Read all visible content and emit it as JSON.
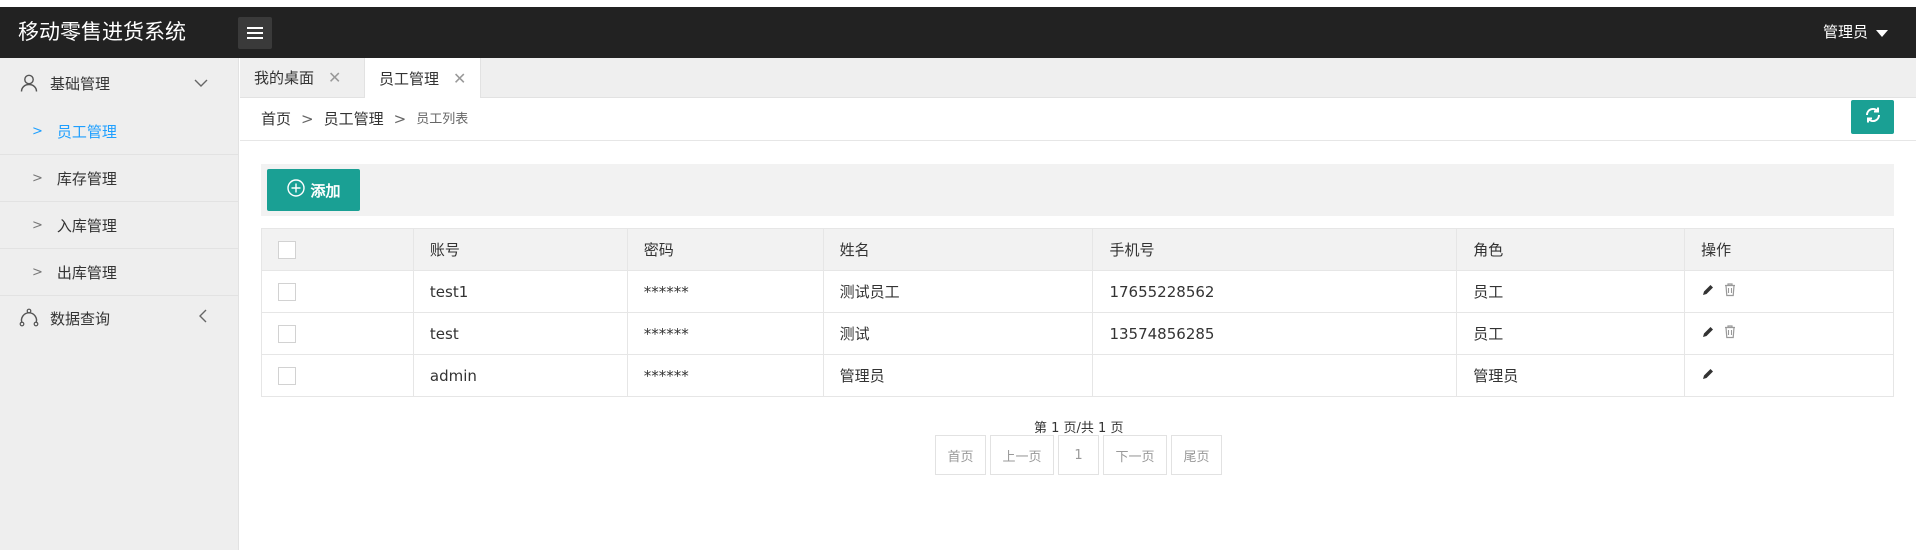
{
  "header": {
    "app_title": "移动零售进货系统",
    "user_label": "管理员"
  },
  "sidebar": {
    "groups": [
      {
        "label": "基础管理",
        "icon": "user-icon",
        "expanded": true,
        "items": [
          {
            "label": "员工管理",
            "active": true
          },
          {
            "label": "库存管理",
            "active": false
          },
          {
            "label": "入库管理",
            "active": false
          },
          {
            "label": "出库管理",
            "active": false
          }
        ]
      },
      {
        "label": "数据查询",
        "icon": "chart-icon",
        "expanded": false,
        "items": []
      }
    ]
  },
  "tabs": [
    {
      "label": "我的桌面",
      "active": false
    },
    {
      "label": "员工管理",
      "active": true
    }
  ],
  "breadcrumb": {
    "items": [
      "首页",
      "员工管理",
      "员工列表"
    ],
    "separator": ">"
  },
  "toolbar": {
    "add_label": "添加"
  },
  "table": {
    "headers": [
      "账号",
      "密码",
      "姓名",
      "手机号",
      "角色",
      "操作"
    ],
    "rows": [
      {
        "account": "test1",
        "password": "******",
        "name": "测试员工",
        "phone": "17655228562",
        "role": "员工",
        "can_delete": true
      },
      {
        "account": "test",
        "password": "******",
        "name": "测试",
        "phone": "13574856285",
        "role": "员工",
        "can_delete": true
      },
      {
        "account": "admin",
        "password": "******",
        "name": "管理员",
        "phone": "",
        "role": "管理员",
        "can_delete": false
      }
    ]
  },
  "pagination": {
    "info": "第 1 页/共 1 页",
    "first": "首页",
    "prev": "上一页",
    "current": "1",
    "next": "下一页",
    "last": "尾页"
  },
  "colors": {
    "header_bg": "#222222",
    "accent": "#1aa094",
    "active_link": "#1e9fff"
  }
}
